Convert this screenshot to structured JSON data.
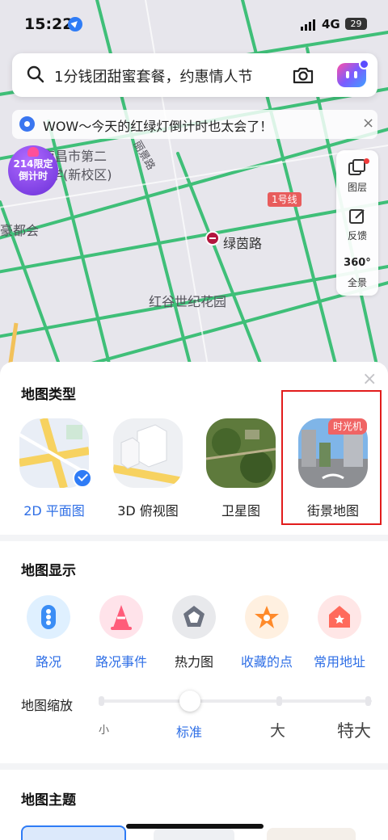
{
  "status_bar": {
    "time": "15:22",
    "network": "4G",
    "battery": "29"
  },
  "search": {
    "query": "1分钱团甜蜜套餐，约惠情人节"
  },
  "notice": {
    "text": "WOW～今天的红绿灯倒计时也太会了！",
    "close": "×"
  },
  "promo": {
    "line1": "214限定",
    "line2": "倒计时"
  },
  "map_labels": {
    "school": "南昌市第二",
    "school2": "学(新校区)",
    "campus": "(新校区)",
    "road": "绿茵路",
    "road2": "丽景路",
    "community": "红谷世纪花园",
    "mall": "豪都会",
    "metro_line": "1号线"
  },
  "tools": [
    {
      "label": "图层",
      "icon": "layers-icon"
    },
    {
      "label": "反馈",
      "icon": "feedback-icon"
    },
    {
      "label": "全景",
      "icon": "panorama-360-icon",
      "badge": "360°"
    }
  ],
  "sheet": {
    "close": "×",
    "map_type_title": "地图类型",
    "map_types": [
      {
        "label": "2D 平面图",
        "selected": true
      },
      {
        "label": "3D 俯视图",
        "selected": false
      },
      {
        "label": "卫星图",
        "selected": false
      },
      {
        "label": "街景地图",
        "selected": false,
        "badge": "时光机"
      }
    ],
    "display_title": "地图显示",
    "display_items": [
      {
        "label": "路况",
        "icon": "traffic-light-icon",
        "active": true
      },
      {
        "label": "路况事件",
        "icon": "traffic-cone-icon",
        "active": true
      },
      {
        "label": "热力图",
        "icon": "heatmap-pentagon-icon",
        "active": false
      },
      {
        "label": "收藏的点",
        "icon": "star-icon",
        "active": true
      },
      {
        "label": "常用地址",
        "icon": "home-icon",
        "active": true
      }
    ],
    "zoom_title": "地图缩放",
    "zoom_levels": [
      "小",
      "标准",
      "大",
      "特大"
    ],
    "zoom_selected": "标准",
    "theme_title": "地图主题"
  },
  "colors": {
    "accent": "#2f6fe6",
    "road": "#3fbf78",
    "highlight": "#e21c1c"
  }
}
